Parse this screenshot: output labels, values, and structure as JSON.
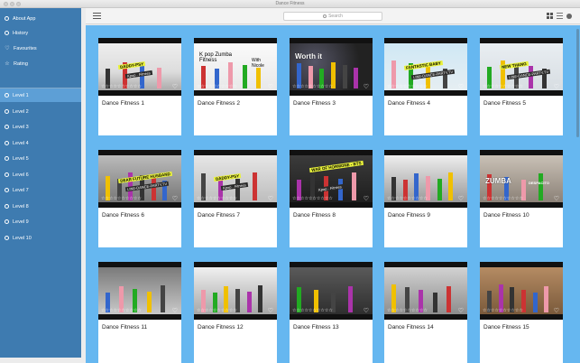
{
  "window": {
    "title": "Dance Fitness"
  },
  "sidebar": {
    "items": [
      {
        "label": "About App",
        "icon": "info-icon"
      },
      {
        "label": "History",
        "icon": "clock-icon"
      },
      {
        "label": "Favourites",
        "icon": "heart-icon"
      },
      {
        "label": "Rating",
        "icon": "star-icon"
      }
    ],
    "levels": [
      {
        "label": "Level 1",
        "active": true
      },
      {
        "label": "Level 2"
      },
      {
        "label": "Level 3"
      },
      {
        "label": "Level 4"
      },
      {
        "label": "Level 5"
      },
      {
        "label": "Level 6"
      },
      {
        "label": "Level 7"
      },
      {
        "label": "Level 8"
      },
      {
        "label": "Level 9"
      },
      {
        "label": "Level 10"
      }
    ]
  },
  "toolbar": {
    "search_placeholder": "Search"
  },
  "videos": [
    {
      "title": "Dance Fitness 1",
      "overlay": "DADDY-PSY",
      "sub": "Kpop · Fitness"
    },
    {
      "title": "Dance Fitness 2",
      "overlay": "K pop Zumba Fitness",
      "sub": "With Nicole"
    },
    {
      "title": "Dance Fitness 3",
      "overlay": "Worth it",
      "sub": ""
    },
    {
      "title": "Dance Fitness 4",
      "overlay": "FANTASTIC BABY",
      "sub": "LINE-DANCE-PARTY.TV"
    },
    {
      "title": "Dance Fitness 5",
      "overlay": "NEW THANG",
      "sub": "LINE-DANCE-PARTY.TV"
    },
    {
      "title": "Dance Fitness 6",
      "overlay": "DEAR FUTURE HUSBAND",
      "sub": "LINE-DANCE-PARTY.TV"
    },
    {
      "title": "Dance Fitness 7",
      "overlay": "DADDY-PSY",
      "sub": "Kpop · Fitness"
    },
    {
      "title": "Dance Fitness 8",
      "overlay": "WAR OF HORMONE - BTS",
      "sub": "Kpop · Fitness"
    },
    {
      "title": "Dance Fitness 9",
      "overlay": "",
      "sub": ""
    },
    {
      "title": "Dance Fitness 10",
      "overlay": "ZUMBA",
      "sub": "DESPACITO"
    },
    {
      "title": "Dance Fitness 11",
      "overlay": "",
      "sub": ""
    },
    {
      "title": "Dance Fitness 12",
      "overlay": "",
      "sub": ""
    },
    {
      "title": "Dance Fitness 13",
      "overlay": "",
      "sub": ""
    },
    {
      "title": "Dance Fitness 14",
      "overlay": "",
      "sub": ""
    },
    {
      "title": "Dance Fitness 15",
      "overlay": "",
      "sub": ""
    }
  ],
  "rating_stars": "☆☆☆☆☆☆☆☆☆☆",
  "colors": {
    "sidebar": "#3e7bb0",
    "sidebar_active": "#5d9fd6",
    "content_bg": "#66b7f0"
  }
}
